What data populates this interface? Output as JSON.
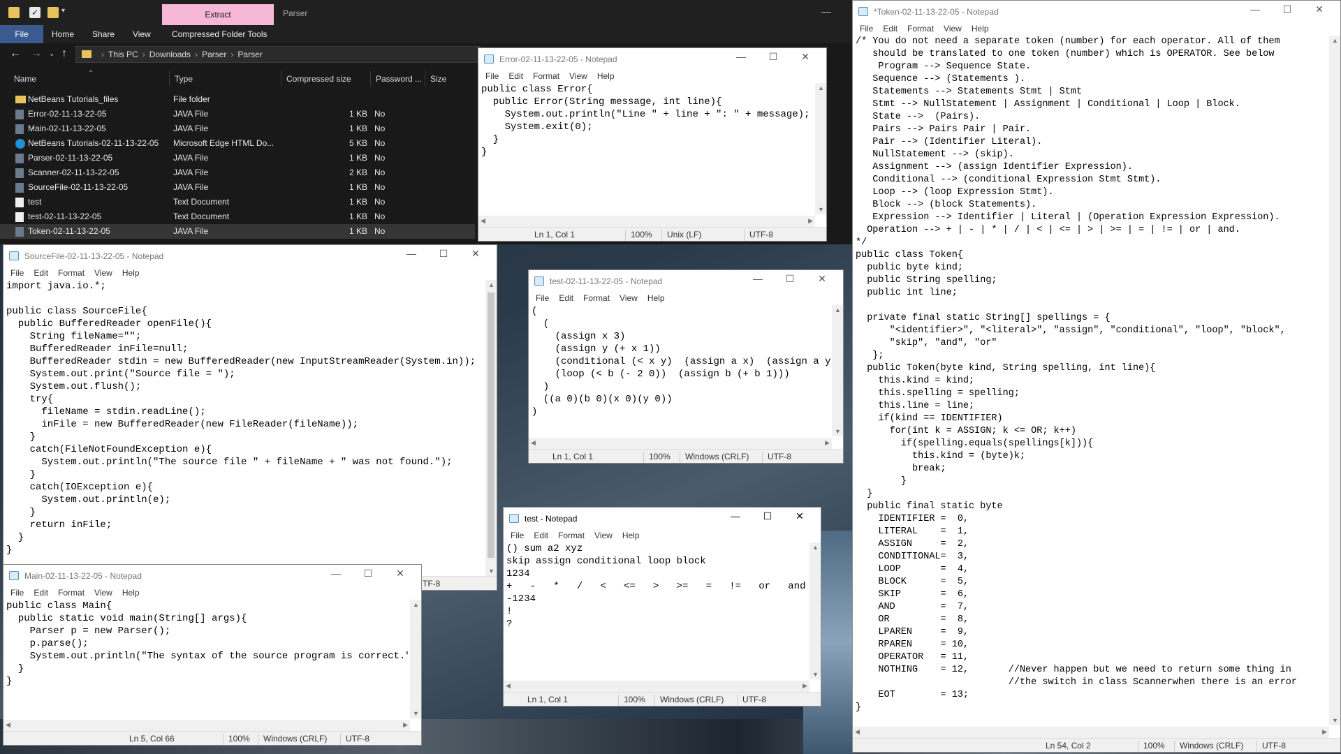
{
  "explorer": {
    "context_tab": "Extract",
    "title": "Parser",
    "ribbon_tabs": [
      "File",
      "Home",
      "Share",
      "View",
      "Compressed Folder Tools"
    ],
    "breadcrumb": [
      "This PC",
      "Downloads",
      "Parser",
      "Parser"
    ],
    "columns": [
      "Name",
      "Type",
      "Compressed size",
      "Password ...",
      "Size"
    ],
    "files": [
      {
        "name": "NetBeans Tutorials_files",
        "type": "File folder",
        "size": "",
        "password": "",
        "icon": "folder-icon"
      },
      {
        "name": "Error-02-11-13-22-05",
        "type": "JAVA File",
        "size": "1 KB",
        "password": "No",
        "icon": "java-file-icon"
      },
      {
        "name": "Main-02-11-13-22-05",
        "type": "JAVA File",
        "size": "1 KB",
        "password": "No",
        "icon": "java-file-icon"
      },
      {
        "name": "NetBeans Tutorials-02-11-13-22-05",
        "type": "Microsoft Edge HTML Do...",
        "size": "5 KB",
        "password": "No",
        "icon": "edge-html-icon"
      },
      {
        "name": "Parser-02-11-13-22-05",
        "type": "JAVA File",
        "size": "1 KB",
        "password": "No",
        "icon": "java-file-icon"
      },
      {
        "name": "Scanner-02-11-13-22-05",
        "type": "JAVA File",
        "size": "2 KB",
        "password": "No",
        "icon": "java-file-icon"
      },
      {
        "name": "SourceFile-02-11-13-22-05",
        "type": "JAVA File",
        "size": "1 KB",
        "password": "No",
        "icon": "java-file-icon"
      },
      {
        "name": "test",
        "type": "Text Document",
        "size": "1 KB",
        "password": "No",
        "icon": "text-file-icon"
      },
      {
        "name": "test-02-11-13-22-05",
        "type": "Text Document",
        "size": "1 KB",
        "password": "No",
        "icon": "text-file-icon"
      },
      {
        "name": "Token-02-11-13-22-05",
        "type": "JAVA File",
        "size": "1 KB",
        "password": "No",
        "icon": "java-file-icon"
      }
    ]
  },
  "notepad_menu": [
    "File",
    "Edit",
    "Format",
    "View",
    "Help"
  ],
  "error_np": {
    "title": "Error-02-11-13-22-05 - Notepad",
    "content": "public class Error{\n  public Error(String message, int line){\n    System.out.println(\"Line \" + line + \": \" + message);\n    System.exit(0);\n  }\n}",
    "status": {
      "pos": "Ln 1, Col 1",
      "zoom": "100%",
      "eol": "Unix (LF)",
      "enc": "UTF-8"
    }
  },
  "sourcefile_np": {
    "title": "SourceFile-02-11-13-22-05 - Notepad",
    "content": "import java.io.*;\n\npublic class SourceFile{\n  public BufferedReader openFile(){\n    String fileName=\"\";\n    BufferedReader inFile=null;\n    BufferedReader stdin = new BufferedReader(new InputStreamReader(System.in));\n    System.out.print(\"Source file = \");\n    System.out.flush();\n    try{\n      fileName = stdin.readLine();\n      inFile = new BufferedReader(new FileReader(fileName));\n    }\n    catch(FileNotFoundException e){\n      System.out.println(\"The source file \" + fileName + \" was not found.\");\n    }\n    catch(IOException e){\n      System.out.println(e);\n    }\n    return inFile;\n  }\n}",
    "status_visible": "TF-8"
  },
  "main_np": {
    "title": "Main-02-11-13-22-05 - Notepad",
    "content": "public class Main{\n  public static void main(String[] args){\n    Parser p = new Parser();\n    p.parse();\n    System.out.println(\"The syntax of the source program is correct.\");\n  }\n}",
    "status": {
      "pos": "Ln 5, Col 66",
      "zoom": "100%",
      "eol": "Windows (CRLF)",
      "enc": "UTF-8"
    }
  },
  "test0205_np": {
    "title": "test-02-11-13-22-05 - Notepad",
    "content": "(\n  (\n    (assign x 3)\n    (assign y (+ x 1))\n    (conditional (< x y)  (assign a x)  (assign a y))\n    (loop (< b (- 2 0))  (assign b (+ b 1)))\n  )\n  ((a 0)(b 0)(x 0)(y 0))\n)",
    "status": {
      "pos": "Ln 1, Col 1",
      "zoom": "100%",
      "eol": "Windows (CRLF)",
      "enc": "UTF-8"
    }
  },
  "test_np": {
    "title": "test - Notepad",
    "content": "() sum a2 xyz\nskip assign conditional loop block\n1234\n+   -   *   /   <   <=   >   >=   =   !=   or   and\n-1234\n!\n?",
    "status": {
      "pos": "Ln 1, Col 1",
      "zoom": "100%",
      "eol": "Windows (CRLF)",
      "enc": "UTF-8"
    }
  },
  "token_np": {
    "title": "*Token-02-11-13-22-05 - Notepad",
    "content": "/* You do not need a separate token (number) for each operator. All of them\n   should be translated to one token (number) which is OPERATOR. See below\n    Program --> Sequence State.\n   Sequence --> (Statements ).\n   Statements --> Statements Stmt | Stmt\n   Stmt --> NullStatement | Assignment | Conditional | Loop | Block.\n   State -->  (Pairs).\n   Pairs --> Pairs Pair | Pair.\n   Pair --> (Identifier Literal).\n   NullStatement --> (skip).\n   Assignment --> (assign Identifier Expression).\n   Conditional --> (conditional Expression Stmt Stmt).\n   Loop --> (loop Expression Stmt).\n   Block --> (block Statements).\n   Expression --> Identifier | Literal | (Operation Expression Expression).\n  Operation --> + | - | * | / | < | <= | > | >= | = | != | or | and.\n*/\npublic class Token{\n  public byte kind;\n  public String spelling;\n  public int line;\n\n  private final static String[] spellings = {\n      \"<identifier>\", \"<literal>\", \"assign\", \"conditional\", \"loop\", \"block\",\n      \"skip\", \"and\", \"or\"\n   };\n  public Token(byte kind, String spelling, int line){\n    this.kind = kind;\n    this.spelling = spelling;\n    this.line = line;\n    if(kind == IDENTIFIER)\n      for(int k = ASSIGN; k <= OR; k++)\n        if(spelling.equals(spellings[k])){\n          this.kind = (byte)k;\n          break;\n        }\n  }\n  public final static byte\n    IDENTIFIER =  0,\n    LITERAL    =  1,\n    ASSIGN     =  2,\n    CONDITIONAL=  3,\n    LOOP       =  4,\n    BLOCK      =  5,\n    SKIP       =  6,\n    AND        =  7,\n    OR         =  8,\n    LPAREN     =  9,\n    RPAREN     = 10,\n    OPERATOR   = 11,\n    NOTHING    = 12,       //Never happen but we need to return some thing in\n                           //the switch in class Scannerwhen there is an error\n    EOT        = 13;\n}",
    "status": {
      "pos": "Ln 54, Col 2",
      "zoom": "100%",
      "eol": "Windows (CRLF)",
      "enc": "UTF-8"
    }
  }
}
